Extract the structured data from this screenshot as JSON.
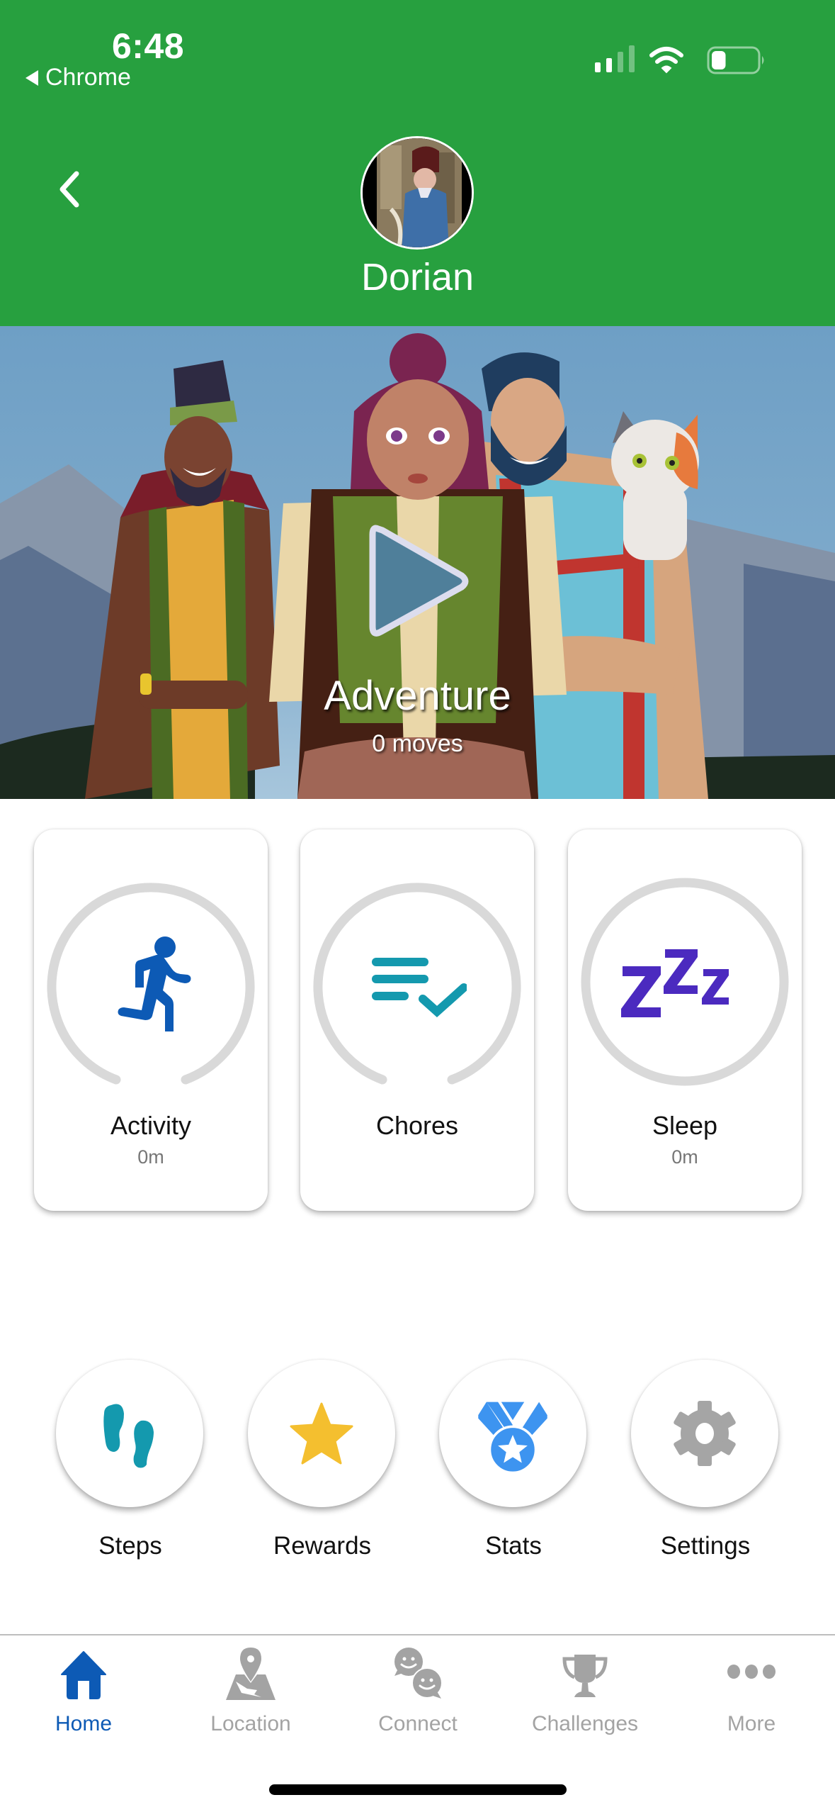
{
  "status_bar": {
    "time": "6:48",
    "back_app": "Chrome",
    "signal_bars_active": 2,
    "signal_bars_total": 4,
    "wifi": "wifi-icon",
    "battery_level": 0.25
  },
  "header": {
    "back": "chevron-left-icon",
    "avatar": "child-profile-photo",
    "name": "Dorian",
    "background_color": "#27A03F"
  },
  "banner": {
    "title": "Adventure",
    "subtitle": "0 moves",
    "play": "play-icon"
  },
  "cards": [
    {
      "label": "Activity",
      "value": "0m",
      "icon": "running-person-icon",
      "icon_color": "#0D5AB5",
      "ring": "open"
    },
    {
      "label": "Chores",
      "value": "",
      "icon": "checklist-icon",
      "icon_color": "#1499AE",
      "ring": "open"
    },
    {
      "label": "Sleep",
      "value": "0m",
      "icon": "zzz-icon",
      "icon_color": "#4B2ABF",
      "ring": "closed"
    }
  ],
  "shortcuts": [
    {
      "label": "Steps",
      "icon": "footprints-icon",
      "icon_color": "#1499AE"
    },
    {
      "label": "Rewards",
      "icon": "star-icon",
      "icon_color": "#F4BF2F"
    },
    {
      "label": "Stats",
      "icon": "medal-icon",
      "icon_color": "#3D94F0"
    },
    {
      "label": "Settings",
      "icon": "gear-icon",
      "icon_color": "#A5A5A5"
    }
  ],
  "tabs": [
    {
      "label": "Home",
      "icon": "home-icon",
      "active": true
    },
    {
      "label": "Location",
      "icon": "map-pin-icon",
      "active": false
    },
    {
      "label": "Connect",
      "icon": "chat-faces-icon",
      "active": false
    },
    {
      "label": "Challenges",
      "icon": "trophy-icon",
      "active": false
    },
    {
      "label": "More",
      "icon": "more-dots-icon",
      "active": false
    }
  ],
  "colors": {
    "active_tab": "#0D5AB5",
    "inactive_tab": "#A3A3A3",
    "ring": "#D9D9D9"
  }
}
